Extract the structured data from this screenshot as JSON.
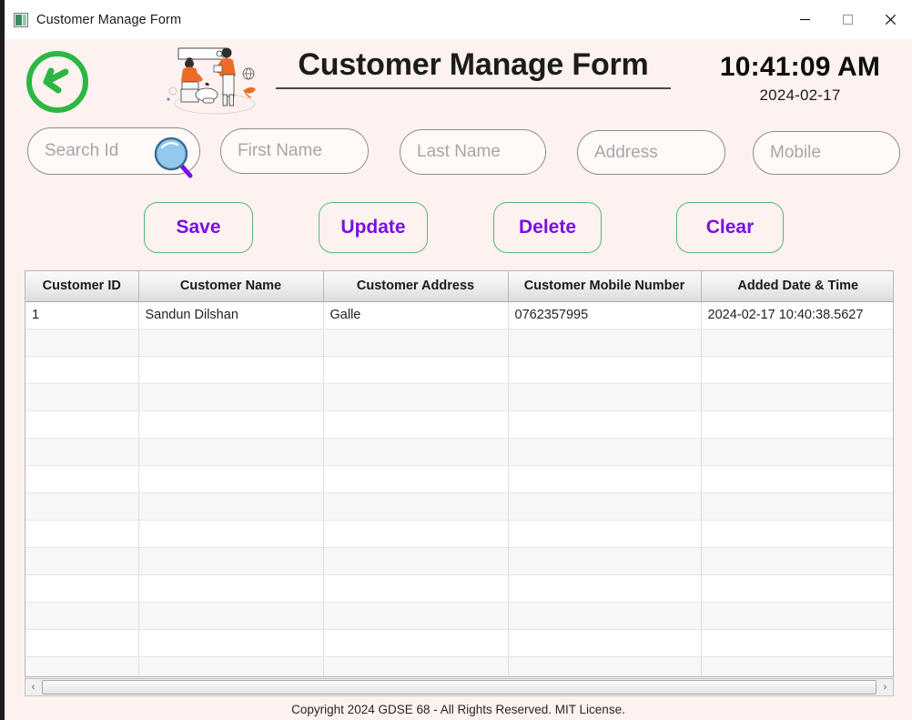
{
  "window": {
    "title": "Customer Manage Form",
    "icon": "app-window-icon",
    "controls": {
      "minimize": "minimize-icon",
      "maximize": "maximize-icon",
      "close": "close-icon"
    }
  },
  "header": {
    "back_icon": "back-arrow-circle-icon",
    "illustration": "people-search-illustration",
    "app_title": "Customer Manage Form",
    "clock_time": "10:41:09 AM",
    "clock_date": "2024-02-17"
  },
  "search_fields": [
    {
      "name": "search-id",
      "placeholder": "Search Id"
    },
    {
      "name": "first-name",
      "placeholder": "First Name"
    },
    {
      "name": "last-name",
      "placeholder": "Last Name"
    },
    {
      "name": "address",
      "placeholder": "Address"
    },
    {
      "name": "mobile",
      "placeholder": "Mobile"
    }
  ],
  "search_icon": "magnifier-icon",
  "buttons": {
    "save": "Save",
    "update": "Update",
    "delete": "Delete",
    "clear": "Clear"
  },
  "table": {
    "columns": [
      "Customer ID",
      "Customer Name",
      "Customer Address",
      "Customer Mobile Number",
      "Added Date & Time"
    ],
    "rows": [
      [
        "1",
        "Sandun Dilshan",
        "Galle",
        "0762357995",
        "2024-02-17 10:40:38.5627"
      ],
      [
        "",
        "",
        "",
        "",
        ""
      ],
      [
        "",
        "",
        "",
        "",
        ""
      ],
      [
        "",
        "",
        "",
        "",
        ""
      ],
      [
        "",
        "",
        "",
        "",
        ""
      ],
      [
        "",
        "",
        "",
        "",
        ""
      ],
      [
        "",
        "",
        "",
        "",
        ""
      ],
      [
        "",
        "",
        "",
        "",
        ""
      ],
      [
        "",
        "",
        "",
        "",
        ""
      ],
      [
        "",
        "",
        "",
        "",
        ""
      ],
      [
        "",
        "",
        "",
        "",
        ""
      ],
      [
        "",
        "",
        "",
        "",
        ""
      ],
      [
        "",
        "",
        "",
        "",
        ""
      ],
      [
        "",
        "",
        "",
        "",
        ""
      ],
      [
        "",
        "",
        "",
        "",
        ""
      ]
    ]
  },
  "scrollbar": {
    "left_arrow": "chevron-left-icon",
    "right_arrow": "chevron-right-icon"
  },
  "footer": {
    "text": "Copyright 2024 GDSE 68 - All Rights Reserved. MIT License."
  },
  "colors": {
    "background": "#fdf2ef",
    "accent_green": "#2cb742",
    "accent_purple": "#7a10e0",
    "button_border": "#52b878"
  }
}
